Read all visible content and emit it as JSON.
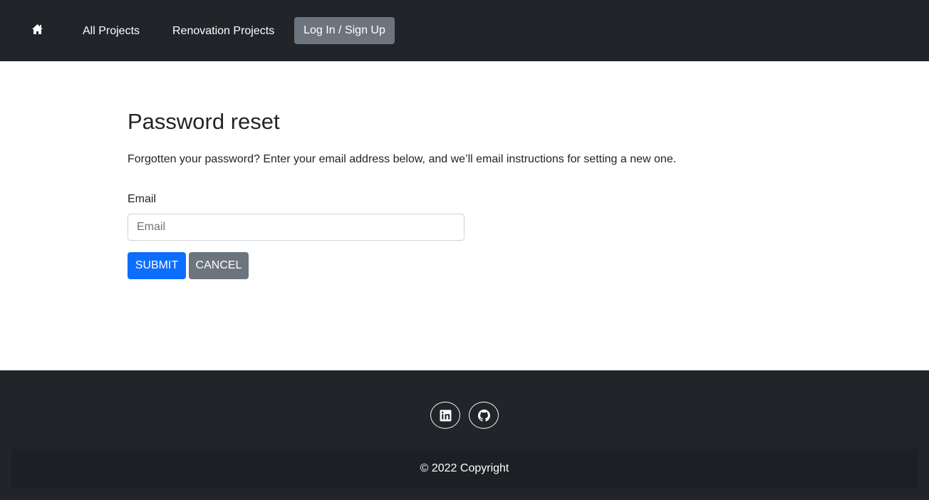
{
  "navbar": {
    "home_icon": "house-icon",
    "links": [
      {
        "label": "All Projects"
      },
      {
        "label": "Renovation Projects"
      }
    ],
    "login_label": "Log In / Sign Up"
  },
  "main": {
    "title": "Password reset",
    "intro": "Forgotten your password? Enter your email address below, and we’ll email instructions for setting a new one.",
    "email_label": "Email",
    "email_placeholder": "Email",
    "email_value": "",
    "submit_label": "SUBMIT",
    "cancel_label": "CANCEL"
  },
  "footer": {
    "social_icons": [
      "linkedin-icon",
      "github-icon"
    ],
    "copyright": "© 2022 Copyright"
  },
  "colors": {
    "navbar_bg": "#212529",
    "secondary_button": "#6c757d",
    "primary_button": "#0d6efd",
    "copyright_bar_bg": "#1c1f23"
  }
}
